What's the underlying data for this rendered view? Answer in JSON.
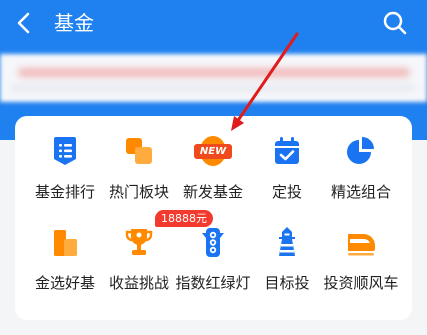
{
  "colors": {
    "primary": "#1a74f2",
    "header_blue": "#1f80f0",
    "orange": "#ff8a00",
    "orange_light": "#ffab3d",
    "badge_red": "#f23a2e",
    "new_red": "#ef4a1d",
    "arrow_red": "#e01b1b"
  },
  "header": {
    "title": "基金",
    "back_icon": "chevron-left-icon",
    "search_icon": "search-icon"
  },
  "menu": {
    "items": [
      {
        "label": "基金排行",
        "icon": "fund-ranking-icon"
      },
      {
        "label": "热门板块",
        "icon": "hot-sectors-icon"
      },
      {
        "label": "新发基金",
        "icon": "new-fund-icon",
        "icon_text": "NEW"
      },
      {
        "label": "定投",
        "icon": "calendar-check-icon"
      },
      {
        "label": "精选组合",
        "icon": "pie-chart-icon"
      },
      {
        "label": "金选好基",
        "icon": "stacked-blocks-icon"
      },
      {
        "label": "收益挑战",
        "icon": "trophy-icon"
      },
      {
        "label": "指数红绿灯",
        "icon": "traffic-light-icon",
        "badge": "18888元"
      },
      {
        "label": "目标投",
        "icon": "lighthouse-icon"
      },
      {
        "label": "投资顺风车",
        "icon": "train-icon"
      }
    ]
  }
}
